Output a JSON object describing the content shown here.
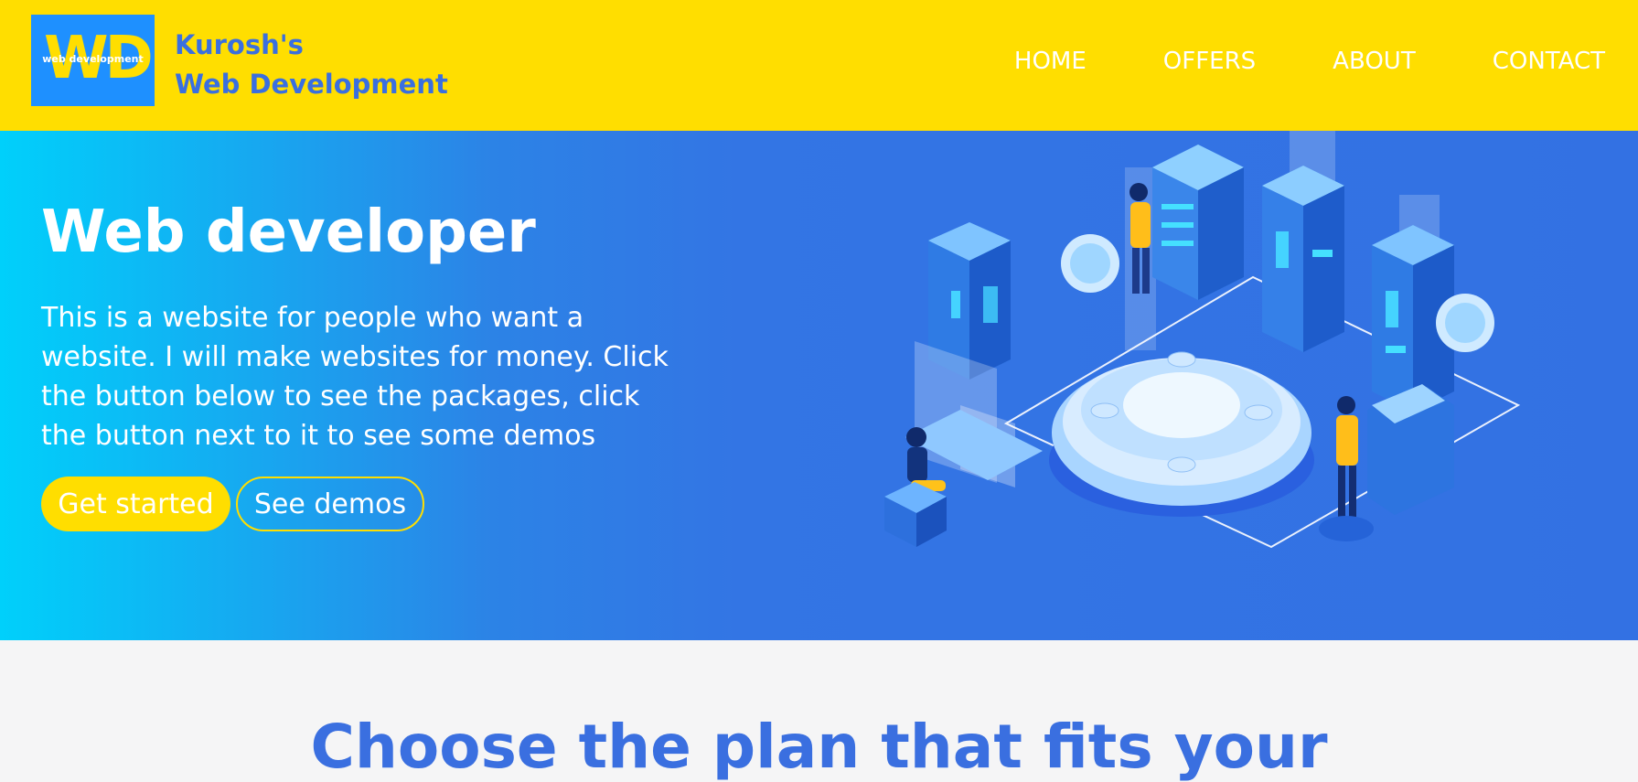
{
  "header": {
    "logo_text": "WD",
    "logo_subtext": "web development",
    "brand_line1": "Kurosh's",
    "brand_line2": "Web Development",
    "nav": [
      "HOME",
      "OFFERS",
      "ABOUT",
      "CONTACT"
    ]
  },
  "hero": {
    "title": "Web developer",
    "description": "This is a website for people who want a website. I will make websites for money. Click the button below to see the packages, click the button next to it to see some demos",
    "primary_button": "Get started",
    "secondary_button": "See demos"
  },
  "plans": {
    "title": "Choose the plan that fits your"
  },
  "colors": {
    "header_bg": "#ffde00",
    "accent_blue": "#3a6fe0",
    "hero_gradient_start": "#00d0fb",
    "hero_gradient_end": "#3371e3"
  }
}
